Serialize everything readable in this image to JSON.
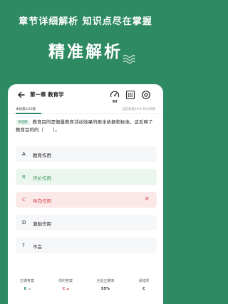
{
  "promo": {
    "subtitle": "章节详细解析  知识点尽在掌握",
    "title": "精准解析"
  },
  "header": {
    "chapter_title": "第一章  教育学",
    "speed_label": "倍速"
  },
  "meta": {
    "count_label": "本组第2/20题",
    "progress_text": "当前进度10%  共230题",
    "progress_fraction": 0.1
  },
  "question": {
    "type_badge": "单选题",
    "text": "教育目的是衡量教育活动效果的根本依据和标准，这反映了教育目的的（　　）。"
  },
  "options": [
    {
      "letter": "A",
      "text": "教育作用",
      "state": "normal"
    },
    {
      "letter": "B",
      "text": "评价作用",
      "state": "correct"
    },
    {
      "letter": "C",
      "text": "导向作用",
      "state": "wrong",
      "mark": "×"
    },
    {
      "letter": "D",
      "text": "激励作用",
      "state": "normal"
    },
    {
      "letter": "?",
      "text": "不会",
      "state": "normal"
    }
  ],
  "stats": {
    "correct_answer_label": "正确答案",
    "correct_answer_value": "B",
    "your_answer_label": "你的答案",
    "your_answer_value": "C",
    "accuracy_label": "全站正确率",
    "accuracy_value": "55%",
    "wrong_option_label": "易错项",
    "wrong_option_value": "C"
  },
  "colors": {
    "brand_green": "#2e8a62",
    "correct_green": "#3d9b5e",
    "wrong_red": "#d8444c"
  }
}
